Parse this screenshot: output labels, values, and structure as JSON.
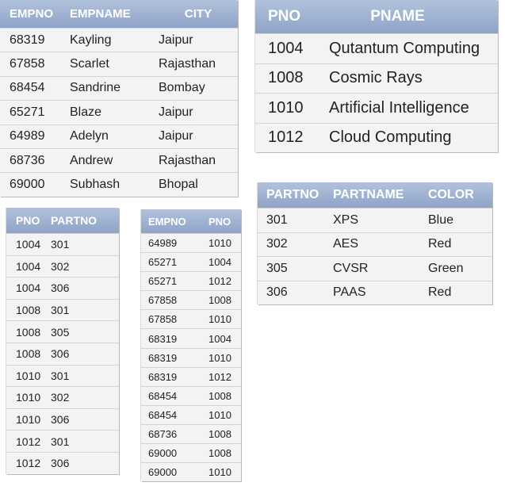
{
  "employee_table": {
    "columns": [
      "EMPNO",
      "EMPNAME",
      "CITY"
    ],
    "rows": [
      [
        "68319",
        "Kayling",
        "Jaipur"
      ],
      [
        "67858",
        "Scarlet",
        "Rajasthan"
      ],
      [
        "68454",
        "Sandrine",
        "Bombay"
      ],
      [
        "65271",
        "Blaze",
        "Jaipur"
      ],
      [
        "64989",
        "Adelyn",
        "Jaipur"
      ],
      [
        "68736",
        "Andrew",
        "Rajasthan"
      ],
      [
        "69000",
        "Subhash",
        "Bhopal"
      ]
    ]
  },
  "project_table": {
    "columns": [
      "PNO",
      "PNAME"
    ],
    "rows": [
      [
        "1004",
        "Qutantum Computing"
      ],
      [
        "1008",
        "Cosmic Rays"
      ],
      [
        "1010",
        "Artificial Intelligence"
      ],
      [
        "1012",
        "Cloud Computing"
      ]
    ]
  },
  "part_table": {
    "columns": [
      "PARTNO",
      "PARTNAME",
      "COLOR"
    ],
    "rows": [
      [
        "301",
        "XPS",
        "Blue"
      ],
      [
        "302",
        "AES",
        "Red"
      ],
      [
        "305",
        "CVSR",
        "Green"
      ],
      [
        "306",
        "PAAS",
        "Red"
      ]
    ]
  },
  "project_part_table": {
    "columns": [
      "PNO",
      "PARTNO"
    ],
    "rows": [
      [
        "1004",
        "301"
      ],
      [
        "1004",
        "302"
      ],
      [
        "1004",
        "306"
      ],
      [
        "1008",
        "301"
      ],
      [
        "1008",
        "305"
      ],
      [
        "1008",
        "306"
      ],
      [
        "1010",
        "301"
      ],
      [
        "1010",
        "302"
      ],
      [
        "1010",
        "306"
      ],
      [
        "1012",
        "301"
      ],
      [
        "1012",
        "306"
      ]
    ]
  },
  "employee_project_table": {
    "columns": [
      "EMPNO",
      "PNO"
    ],
    "rows": [
      [
        "64989",
        "1010"
      ],
      [
        "65271",
        "1004"
      ],
      [
        "65271",
        "1012"
      ],
      [
        "67858",
        "1008"
      ],
      [
        "67858",
        "1010"
      ],
      [
        "68319",
        "1004"
      ],
      [
        "68319",
        "1010"
      ],
      [
        "68319",
        "1012"
      ],
      [
        "68454",
        "1008"
      ],
      [
        "68454",
        "1010"
      ],
      [
        "68736",
        "1008"
      ],
      [
        "69000",
        "1008"
      ],
      [
        "69000",
        "1010"
      ]
    ]
  }
}
